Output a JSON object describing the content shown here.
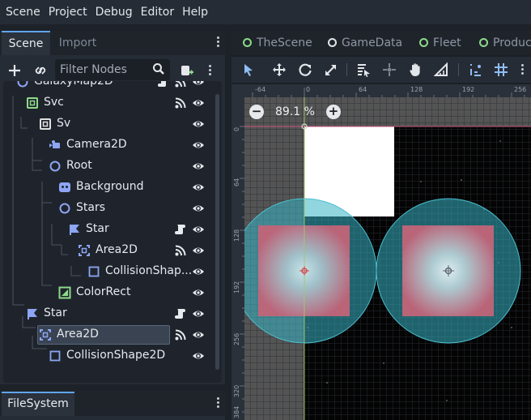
{
  "menu": [
    "Scene",
    "Project",
    "Debug",
    "Editor",
    "Help"
  ],
  "scene_dock": {
    "tabs": {
      "scene": "Scene",
      "import": "Import"
    },
    "filter_placeholder": "Filter Nodes",
    "tree": [
      {
        "label": "GalaxyMap2D",
        "icon": "node2d-icon",
        "signal": true,
        "script": true,
        "visible": true
      },
      {
        "label": "Svc",
        "icon": "subviewport-container-icon",
        "signal": true,
        "script": false,
        "visible": true
      },
      {
        "label": "Sv",
        "icon": "subviewport-icon",
        "signal": false,
        "script": false,
        "visible": false
      },
      {
        "label": "Camera2D",
        "icon": "camera2d-icon",
        "signal": false,
        "script": false,
        "visible": true
      },
      {
        "label": "Root",
        "icon": "node2d-icon",
        "signal": false,
        "script": false,
        "visible": true
      },
      {
        "label": "Background",
        "icon": "parallax-background-icon",
        "signal": false,
        "script": false,
        "visible": true
      },
      {
        "label": "Stars",
        "icon": "node2d-icon",
        "signal": false,
        "script": false,
        "visible": true
      },
      {
        "label": "Star",
        "icon": "star-scene-icon",
        "signal": false,
        "script": true,
        "visible": true
      },
      {
        "label": "Area2D",
        "icon": "area2d-icon",
        "signal": true,
        "script": false,
        "visible": true
      },
      {
        "label": "CollisionShap...",
        "icon": "collisionshape2d-icon",
        "signal": false,
        "script": false,
        "visible": true
      },
      {
        "label": "ColorRect",
        "icon": "colorrect-icon",
        "signal": false,
        "script": false,
        "visible": true
      },
      {
        "label": "Star",
        "icon": "star-scene-icon",
        "signal": false,
        "script": true,
        "visible": true
      },
      {
        "label": "Area2D",
        "icon": "area2d-icon",
        "signal": true,
        "script": false,
        "visible": true,
        "selected": true
      },
      {
        "label": "CollisionShape2D",
        "icon": "collisionshape2d-icon",
        "signal": false,
        "script": false,
        "visible": true
      }
    ]
  },
  "filesystem_dock": {
    "tab": "FileSystem"
  },
  "editor": {
    "scene_tabs": [
      {
        "label": "TheScene",
        "dot": "green"
      },
      {
        "label": "GameData",
        "dot": "white"
      },
      {
        "label": "Fleet",
        "dot": "green"
      },
      {
        "label": "Produc",
        "dot": "green"
      }
    ],
    "toolbar_icons": [
      "select-icon",
      "move-icon",
      "rotate-icon",
      "scale-icon",
      "list-select-icon",
      "pivot-icon",
      "pan-icon",
      "ruler-icon",
      "smart-snap-icon",
      "grid-snap-icon"
    ],
    "zoom": {
      "minus": "−",
      "level": "89.1 %",
      "plus": "+"
    },
    "ruler_h": [
      "-64",
      "0",
      "64",
      "128",
      "192",
      "256"
    ],
    "ruler_v": [
      "0",
      "64",
      "128",
      "192",
      "256",
      "320",
      "384"
    ]
  },
  "colors": {
    "accent": "#60a5f0",
    "node_green": "#8eda8b",
    "node_blue": "#8da5f3",
    "area_cyan": "#2ea8b8",
    "background_black": "#000000"
  }
}
